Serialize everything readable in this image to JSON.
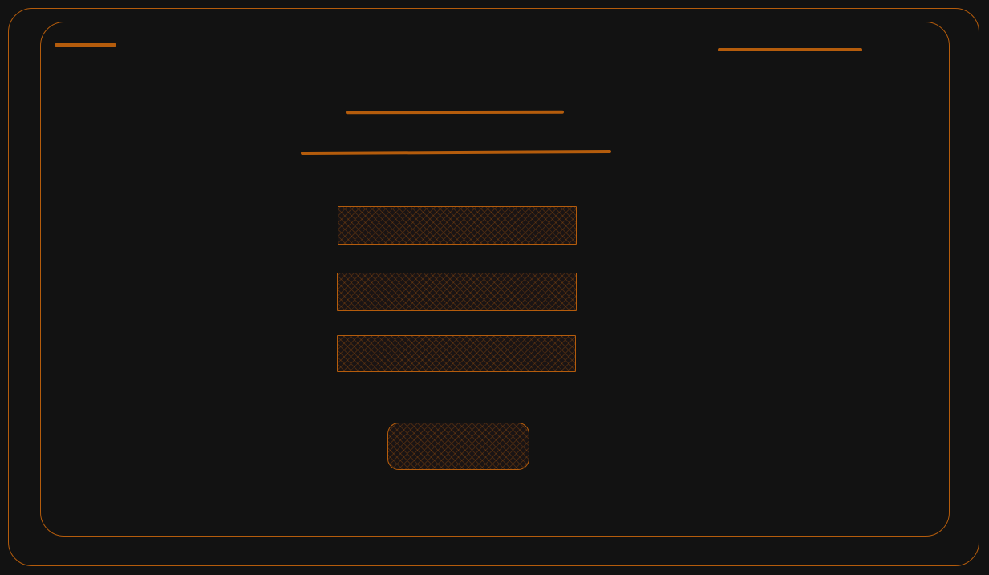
{
  "theme": {
    "background": "#121212",
    "accent": "#b45c0c",
    "field_fill": "#1a1414"
  },
  "header": {
    "logo_placeholder": "",
    "nav_placeholder": ""
  },
  "form": {
    "title_placeholder": "",
    "subtitle_placeholder": "",
    "fields": [
      {
        "value": "",
        "placeholder": ""
      },
      {
        "value": "",
        "placeholder": ""
      },
      {
        "value": "",
        "placeholder": ""
      }
    ],
    "submit_label": ""
  }
}
